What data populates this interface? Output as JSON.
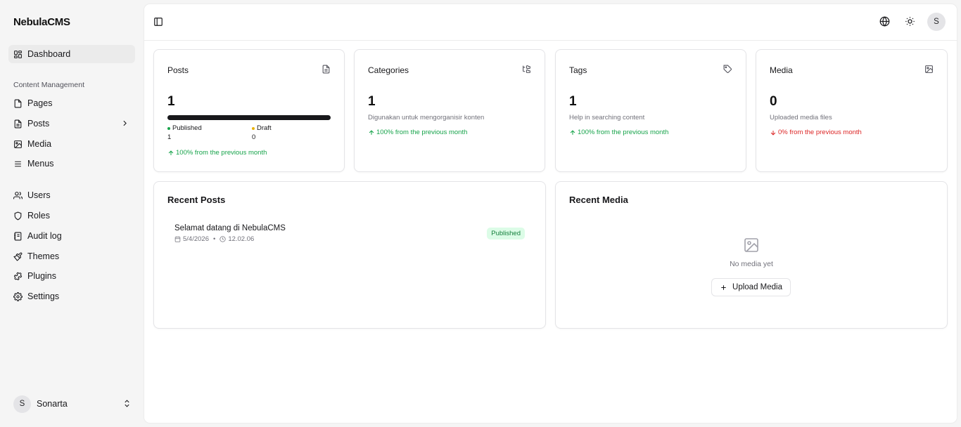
{
  "brand": "NebulaCMS",
  "sidebar": {
    "section_label": "Content Management",
    "items": [
      {
        "label": "Dashboard"
      },
      {
        "label": "Pages"
      },
      {
        "label": "Posts"
      },
      {
        "label": "Media"
      },
      {
        "label": "Menus"
      },
      {
        "label": "Users"
      },
      {
        "label": "Roles"
      },
      {
        "label": "Audit log"
      },
      {
        "label": "Themes"
      },
      {
        "label": "Plugins"
      },
      {
        "label": "Settings"
      }
    ],
    "user": {
      "initial": "S",
      "name": "Sonarta"
    }
  },
  "topbar": {
    "avatar_initial": "S"
  },
  "cards": {
    "posts": {
      "title": "Posts",
      "value": "1",
      "published_label": "Published",
      "published_value": "1",
      "draft_label": "Draft",
      "draft_value": "0",
      "published_fraction": 1.0,
      "trend": "100% from the previous month"
    },
    "categories": {
      "title": "Categories",
      "value": "1",
      "desc": "Digunakan untuk mengorganisir konten",
      "trend": "100% from the previous month"
    },
    "tags": {
      "title": "Tags",
      "value": "1",
      "desc": "Help in searching content",
      "trend": "100% from the previous month"
    },
    "media": {
      "title": "Media",
      "value": "0",
      "desc": "Uploaded media files",
      "trend": "0% from the previous month"
    }
  },
  "recent_posts": {
    "title": "Recent Posts",
    "items": [
      {
        "title": "Selamat datang di NebulaCMS",
        "date": "5/4/2026",
        "time": "12.02.06",
        "status": "Published"
      }
    ]
  },
  "recent_media": {
    "title": "Recent Media",
    "empty_text": "No media yet",
    "upload_label": "Upload Media"
  },
  "colors": {
    "success": "#16a34a",
    "danger": "#dc2626",
    "draft_dot": "#eab308",
    "badge_bg": "#dcfce7"
  }
}
